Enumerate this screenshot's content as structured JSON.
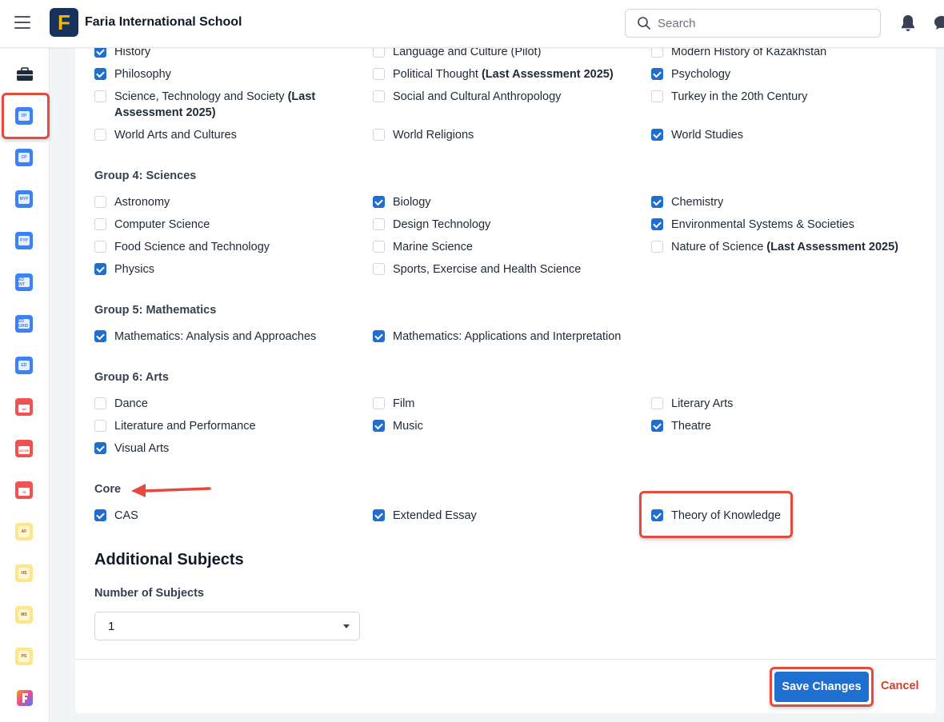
{
  "header": {
    "school_name": "Faria International School",
    "logo_letter": "F",
    "search_placeholder": "Search"
  },
  "rail": {
    "items": [
      {
        "icon": "briefcase-icon",
        "label": ""
      },
      {
        "icon": "dp-app-icon",
        "label": "DP"
      },
      {
        "icon": "cp-app-icon",
        "label": "CP"
      },
      {
        "icon": "myp-app-icon",
        "label": "MYP"
      },
      {
        "icon": "pyp-app-icon",
        "label": "PYP"
      },
      {
        "icon": "ed-int-app-icon",
        "label": "ED INT"
      },
      {
        "icon": "ed-grid-app-icon",
        "label": "ED GRID"
      },
      {
        "icon": "ed-app-icon",
        "label": "ED"
      },
      {
        "icon": "as-app-icon",
        "label": "AS"
      },
      {
        "icon": "igcse-app-icon",
        "label": "IGCSE"
      },
      {
        "icon": "js-app-icon",
        "label": "JS"
      },
      {
        "icon": "af-app-icon",
        "label": "AF"
      },
      {
        "icon": "hs-app-icon",
        "label": "HS"
      },
      {
        "icon": "ms-app-icon",
        "label": "MS"
      },
      {
        "icon": "ps-app-icon",
        "label": "PS"
      },
      {
        "icon": "faria-app-icon",
        "label": ""
      }
    ]
  },
  "groups": {
    "g3": {
      "col1": [
        {
          "label": "History",
          "checked": true
        },
        {
          "label": "Philosophy",
          "checked": true
        },
        {
          "label": "Science, Technology and Society",
          "suffix": "(Last",
          "line2": "Assessment 2025)",
          "checked": false
        },
        {
          "label": "World Arts and Cultures",
          "checked": false
        }
      ],
      "col2": [
        {
          "label": "Language and Culture (Pilot)",
          "checked": false
        },
        {
          "label": "Political Thought",
          "suffix": "(Last Assessment 2025)",
          "checked": false
        },
        {
          "label": "Social and Cultural Anthropology",
          "checked": false
        },
        {
          "label": "World Religions",
          "checked": false
        }
      ],
      "col3": [
        {
          "label": "Modern History of Kazakhstan",
          "checked": false
        },
        {
          "label": "Psychology",
          "checked": true
        },
        {
          "label": "Turkey in the 20th Century",
          "checked": false
        },
        {
          "label": "World Studies",
          "checked": true
        }
      ]
    },
    "g4": {
      "title": "Group 4: Sciences",
      "col1": [
        {
          "label": "Astronomy",
          "checked": false
        },
        {
          "label": "Computer Science",
          "checked": false
        },
        {
          "label": "Food Science and Technology",
          "checked": false
        },
        {
          "label": "Physics",
          "checked": true
        }
      ],
      "col2": [
        {
          "label": "Biology",
          "checked": true
        },
        {
          "label": "Design Technology",
          "checked": false
        },
        {
          "label": "Marine Science",
          "checked": false
        },
        {
          "label": "Sports, Exercise and Health Science",
          "checked": false
        }
      ],
      "col3": [
        {
          "label": "Chemistry",
          "checked": true
        },
        {
          "label": "Environmental Systems & Societies",
          "checked": true
        },
        {
          "label": "Nature of Science",
          "suffix": "(Last Assessment 2025)",
          "checked": false
        }
      ]
    },
    "g5": {
      "title": "Group 5: Mathematics",
      "col1": [
        {
          "label": "Mathematics: Analysis and Approaches",
          "checked": true
        }
      ],
      "col2": [
        {
          "label": "Mathematics: Applications and Interpretation",
          "checked": true
        }
      ]
    },
    "g6": {
      "title": "Group 6: Arts",
      "col1": [
        {
          "label": "Dance",
          "checked": false
        },
        {
          "label": "Literature and Performance",
          "checked": false
        },
        {
          "label": "Visual Arts",
          "checked": true
        }
      ],
      "col2": [
        {
          "label": "Film",
          "checked": false
        },
        {
          "label": "Music",
          "checked": true
        }
      ],
      "col3": [
        {
          "label": "Literary Arts",
          "checked": false
        },
        {
          "label": "Theatre",
          "checked": true
        }
      ]
    },
    "core": {
      "title": "Core",
      "col1": [
        {
          "label": "CAS",
          "checked": true
        }
      ],
      "col2": [
        {
          "label": "Extended Essay",
          "checked": true
        }
      ],
      "col3": [
        {
          "label": "Theory of Knowledge",
          "checked": true
        }
      ]
    }
  },
  "additional": {
    "title": "Additional Subjects",
    "number_label": "Number of Subjects",
    "number_value": "1"
  },
  "footer": {
    "save_label": "Save Changes",
    "cancel_label": "Cancel"
  },
  "colors": {
    "primary": "#1f6fd1",
    "highlight": "#e34b3f",
    "cancel": "#dc3b2f"
  }
}
